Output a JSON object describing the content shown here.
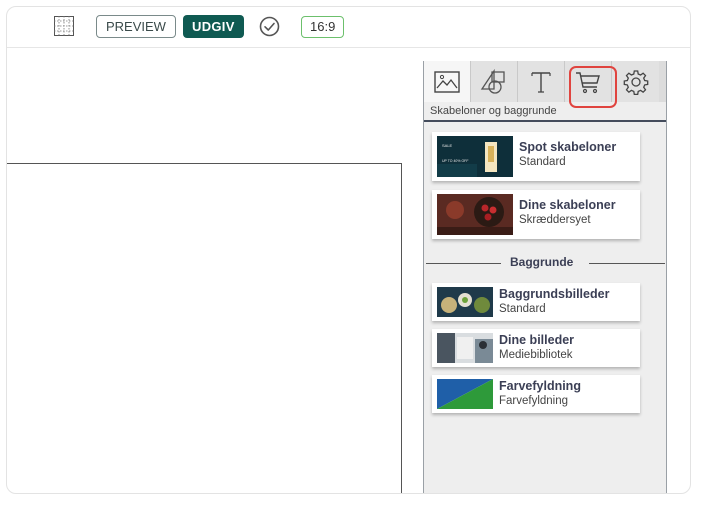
{
  "toolbar": {
    "grid_icon": "grid-icon",
    "preview_label": "PREVIEW",
    "publish_label": "UDGIV",
    "check_icon": "check-circle-icon",
    "ratio_label": "16:9",
    "publish_color": "#0f5a52",
    "ratio_border_color": "#6cc06c"
  },
  "panel": {
    "tabs": [
      {
        "icon": "image-icon"
      },
      {
        "icon": "shapes-icon"
      },
      {
        "icon": "text-icon"
      },
      {
        "icon": "cart-icon"
      },
      {
        "icon": "gear-icon"
      }
    ],
    "highlight_color": "#e0443f",
    "section_label": "Skabeloner og baggrunde",
    "templates": [
      {
        "title": "Spot skabeloner",
        "subtitle": "Standard"
      },
      {
        "title": "Dine skabeloner",
        "subtitle": "Skræddersyet"
      }
    ],
    "backgrounds_heading": "Baggrunde",
    "backgrounds": [
      {
        "title": "Baggrundsbilleder",
        "subtitle": "Standard"
      },
      {
        "title": "Dine billeder",
        "subtitle": "Mediebibliotek"
      },
      {
        "title": "Farvefyldning",
        "subtitle": "Farvefyldning"
      }
    ]
  }
}
